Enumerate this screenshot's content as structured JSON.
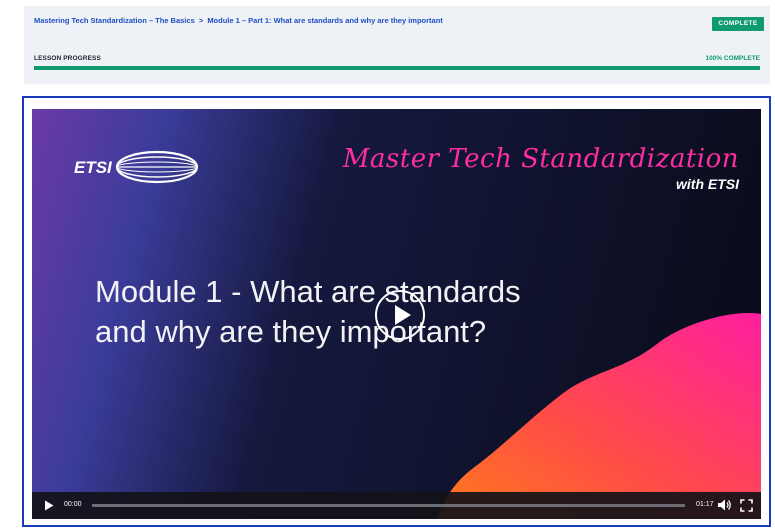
{
  "breadcrumb": {
    "course": "Mastering Tech Standardization – The Basics",
    "separator": ">",
    "lesson": "Module 1 – Part 1: What are standards and why are they important"
  },
  "status_badge": "COMPLETE",
  "lesson_progress": {
    "label": "LESSON PROGRESS",
    "percent_text": "100% COMPLETE",
    "percent": 100
  },
  "video": {
    "logo_text": "ETSI",
    "tagline": "Master Tech Standardization",
    "tagline_sub": "with ETSI",
    "title_line1": "Module 1 - What are standards",
    "title_line2": "and  why are they important?",
    "current_time": "00:00",
    "duration": "01:17",
    "played_fraction": 0
  },
  "colors": {
    "accent_green": "#109a72",
    "link_blue": "#1f4fc4",
    "frame_blue": "#1a3bb8",
    "tagline_pink": "#ff2da3"
  }
}
